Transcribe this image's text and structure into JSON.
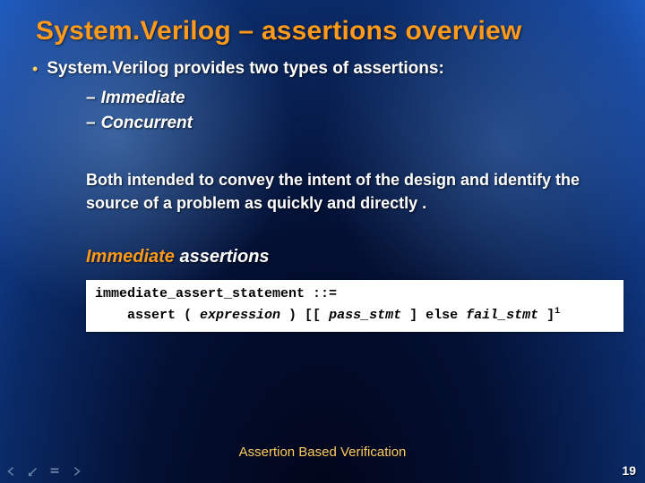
{
  "title": "System.Verilog – assertions overview",
  "lead": "System.Verilog provides two types of assertions:",
  "sub_items": [
    "Immediate",
    "Concurrent"
  ],
  "paragraph": "Both intended to convey the intent of the design and identify the source of a problem as quickly and directly .",
  "subhead": {
    "emph": "Immediate",
    "rest": "assertions"
  },
  "code": {
    "line1_a": "immediate_assert_statement ::=",
    "line2_indent": "    ",
    "line2_a": "assert ( ",
    "line2_b": "expression",
    "line2_c": " ) [[ ",
    "line2_d": "pass_stmt",
    "line2_e": " ] else ",
    "line2_f": "fail_stmt",
    "line2_g": " ]",
    "line2_sup": "1"
  },
  "footer": "Assertion Based Verification",
  "page": "19"
}
